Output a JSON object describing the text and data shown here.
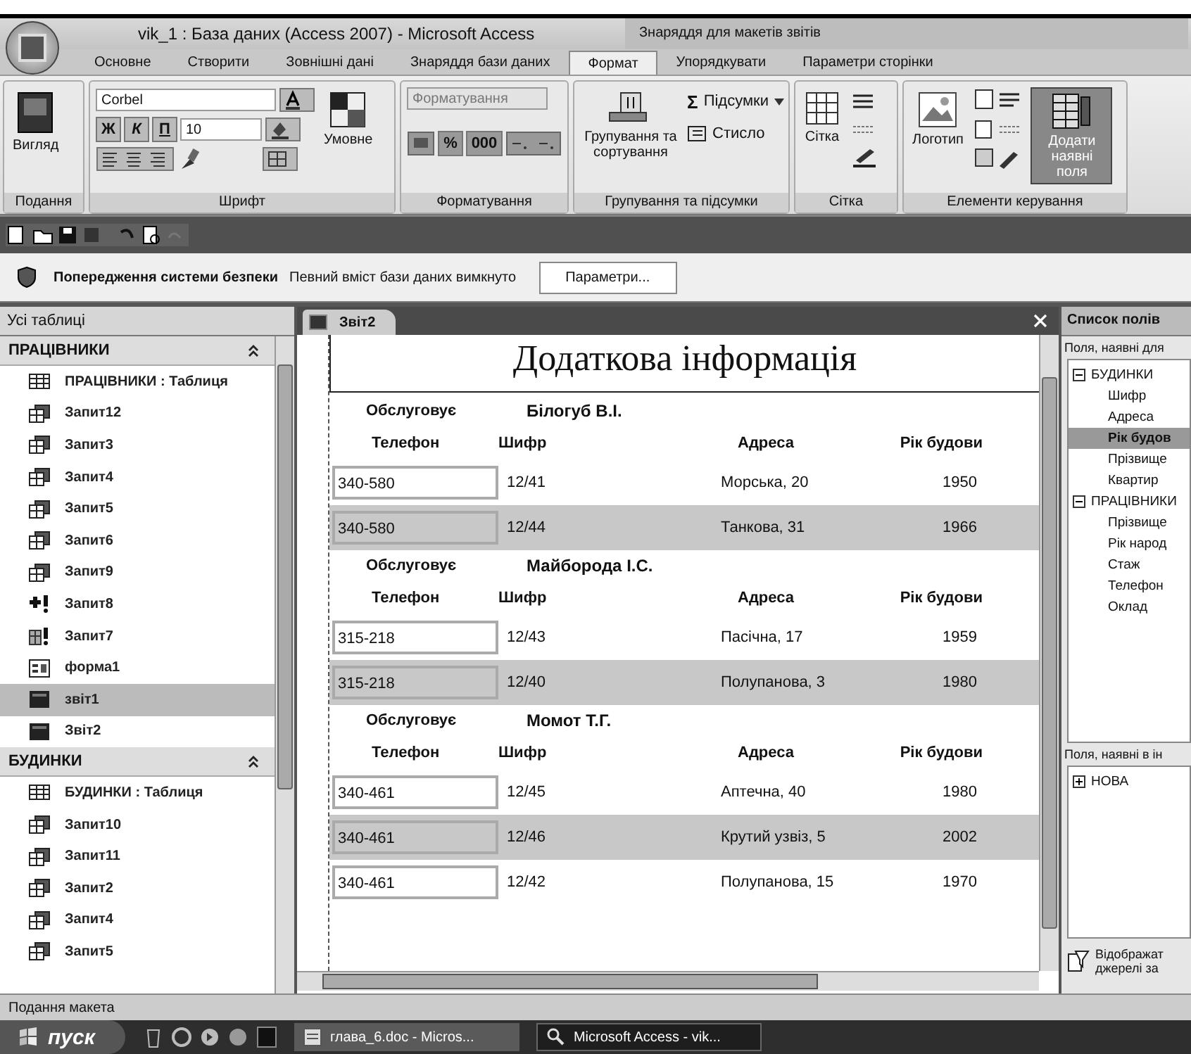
{
  "window": {
    "title": "vik_1 : База даних (Access 2007) - Microsoft Access",
    "context_group": "Знаряддя для макетів звітів"
  },
  "ribbon_tabs": [
    {
      "label": "Основне",
      "selected": false
    },
    {
      "label": "Створити",
      "selected": false
    },
    {
      "label": "Зовнішні дані",
      "selected": false
    },
    {
      "label": "Знаряддя бази даних",
      "selected": false
    },
    {
      "label": "Формат",
      "selected": true
    },
    {
      "label": "Упорядкувати",
      "selected": false
    },
    {
      "label": "Параметри сторінки",
      "selected": false
    }
  ],
  "ribbon_groups": [
    {
      "kind": "view",
      "label": "Подання",
      "button": "Вигляд"
    },
    {
      "kind": "font",
      "label": "Шрифт",
      "font": "Corbel",
      "size": "10",
      "styles": [
        "Ж",
        "К",
        "П"
      ],
      "button": "Умовне"
    },
    {
      "kind": "format",
      "label": "Форматування",
      "dropdown": {
        "value": "Форматування",
        "disabled": true
      },
      "percent": "%",
      "thousands": "000"
    },
    {
      "kind": "grouping",
      "label": "Групування та підсумки",
      "button": "Групування та сортування",
      "totals_icon": "Σ",
      "totals": "Підсумки",
      "compact": "Стисло"
    },
    {
      "kind": "grid",
      "label": "Сітка",
      "button": "Сітка"
    },
    {
      "kind": "controls",
      "label": "Елементи керування",
      "logo": "Логотип",
      "add": {
        "label": "Додати наявні поля",
        "selected": true
      }
    }
  ],
  "security_bar": {
    "title": "Попередження системи безпеки",
    "message": "Певний вміст бази даних вимкнуто",
    "button": "Параметри..."
  },
  "navigation": {
    "header": "Усі таблиці",
    "groups": [
      {
        "title": "ПРАЦІВНИКИ",
        "expanded": true,
        "items": [
          {
            "label": "ПРАЦІВНИКИ : Таблиця",
            "kind": "table",
            "selected": false
          },
          {
            "label": "Запит12",
            "kind": "query",
            "selected": false
          },
          {
            "label": "Запит3",
            "kind": "query",
            "selected": false
          },
          {
            "label": "Запит4",
            "kind": "query",
            "selected": false
          },
          {
            "label": "Запит5",
            "kind": "query",
            "selected": false
          },
          {
            "label": "Запит6",
            "kind": "query",
            "selected": false
          },
          {
            "label": "Запит9",
            "kind": "query",
            "selected": false
          },
          {
            "label": "Запит8",
            "kind": "append",
            "selected": false
          },
          {
            "label": "Запит7",
            "kind": "maketable",
            "selected": false
          },
          {
            "label": "форма1",
            "kind": "form",
            "selected": false
          },
          {
            "label": "звіт1",
            "kind": "report",
            "selected": true
          },
          {
            "label": "Звіт2",
            "kind": "report",
            "selected": false
          }
        ]
      },
      {
        "title": "БУДИНКИ",
        "expanded": true,
        "items": [
          {
            "label": "БУДИНКИ : Таблиця",
            "kind": "table",
            "selected": false
          },
          {
            "label": "Запит10",
            "kind": "query",
            "selected": false
          },
          {
            "label": "Запит11",
            "kind": "query",
            "selected": false
          },
          {
            "label": "Запит2",
            "kind": "query",
            "selected": false
          },
          {
            "label": "Запит4",
            "kind": "query",
            "selected": false
          },
          {
            "label": "Запит5",
            "kind": "query",
            "selected": false
          }
        ]
      }
    ]
  },
  "report": {
    "tab": "Звіт2",
    "title": "Додаткова інформація",
    "groups": [
      {
        "label": "Обслуговує",
        "name": "Білогуб В.І.",
        "columns": [
          "Телефон",
          "Шифр",
          "Адреса",
          "Рік будови"
        ],
        "rows": [
          [
            "340-580",
            "12/41",
            "Морська, 20",
            "1950"
          ],
          [
            "340-580",
            "12/44",
            "Танкова, 31",
            "1966"
          ]
        ]
      },
      {
        "label": "Обслуговує",
        "name": "Майборода І.С.",
        "columns": [
          "Телефон",
          "Шифр",
          "Адреса",
          "Рік будови"
        ],
        "rows": [
          [
            "315-218",
            "12/43",
            "Пасічна, 17",
            "1959"
          ],
          [
            "315-218",
            "12/40",
            "Полупанова, 3",
            "1980"
          ]
        ]
      },
      {
        "label": "Обслуговує",
        "name": "Момот Т.Г.",
        "columns": [
          "Телефон",
          "Шифр",
          "Адреса",
          "Рік будови"
        ],
        "rows": [
          [
            "340-461",
            "12/45",
            "Аптечна, 40",
            "1980"
          ],
          [
            "340-461",
            "12/46",
            "Крутий узвіз, 5",
            "2002"
          ],
          [
            "340-461",
            "12/42",
            "Полупанова, 15",
            "1970"
          ]
        ]
      }
    ]
  },
  "field_list": {
    "title": "Список полів",
    "section_1": "Поля, наявні для",
    "tree_1": [
      {
        "label": "БУДИНКИ",
        "expanded": true,
        "children": [
          {
            "label": "Шифр",
            "selected": false
          },
          {
            "label": "Адреса",
            "selected": false
          },
          {
            "label": "Рік будов",
            "selected": true
          },
          {
            "label": "Прізвище",
            "selected": false
          },
          {
            "label": "Квартир",
            "selected": false
          }
        ]
      },
      {
        "label": "ПРАЦІВНИКИ",
        "expanded": true,
        "children": [
          {
            "label": "Прізвище",
            "selected": false
          },
          {
            "label": "Рік народ",
            "selected": false
          },
          {
            "label": "Стаж",
            "selected": false
          },
          {
            "label": "Телефон",
            "selected": false
          },
          {
            "label": "Оклад",
            "selected": false
          }
        ]
      }
    ],
    "section_2": "Поля, наявні в ін",
    "tree_2": [
      {
        "label": "НОВА",
        "expanded": false
      }
    ],
    "footer": [
      "Відображат",
      "джерелі за"
    ]
  },
  "status_bar": "Подання макета",
  "taskbar": {
    "start": "пуск",
    "tasks": [
      {
        "label": "глава_6.doc - Micros...",
        "selected": false
      },
      {
        "label": "Microsoft Access - vik...",
        "selected": true
      }
    ]
  }
}
